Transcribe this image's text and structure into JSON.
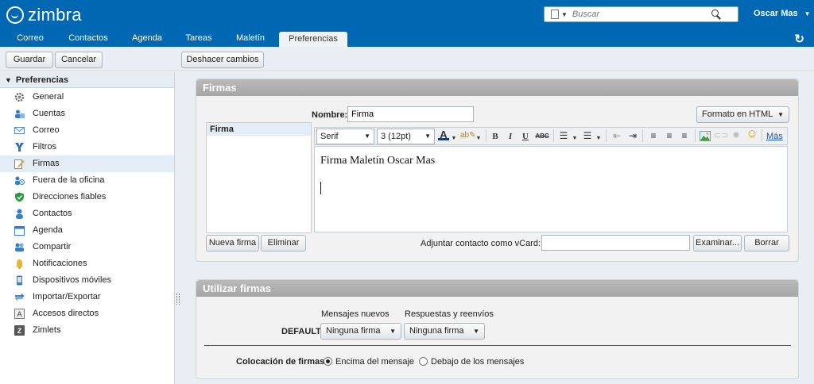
{
  "app": {
    "logo_text": "zimbra",
    "user_name": "Oscar Mas",
    "search_placeholder": "Buscar"
  },
  "tabs": [
    {
      "label": "Correo"
    },
    {
      "label": "Contactos"
    },
    {
      "label": "Agenda"
    },
    {
      "label": "Tareas"
    },
    {
      "label": "Maletín"
    },
    {
      "label": "Preferencias",
      "active": true
    }
  ],
  "toolbar": {
    "save": "Guardar",
    "cancel": "Cancelar",
    "undo": "Deshacer cambios"
  },
  "sidebar": {
    "header": "Preferencias",
    "items": [
      {
        "label": "General",
        "icon": "gear-icon"
      },
      {
        "label": "Cuentas",
        "icon": "accounts-icon"
      },
      {
        "label": "Correo",
        "icon": "mail-icon"
      },
      {
        "label": "Filtros",
        "icon": "filter-icon"
      },
      {
        "label": "Firmas",
        "icon": "signature-icon",
        "selected": true
      },
      {
        "label": "Fuera de la oficina",
        "icon": "out-of-office-icon"
      },
      {
        "label": "Direcciones fiables",
        "icon": "shield-icon"
      },
      {
        "label": "Contactos",
        "icon": "contact-icon"
      },
      {
        "label": "Agenda",
        "icon": "calendar-icon"
      },
      {
        "label": "Compartir",
        "icon": "share-icon"
      },
      {
        "label": "Notificaciones",
        "icon": "bell-icon"
      },
      {
        "label": "Dispositivos móviles",
        "icon": "mobile-icon"
      },
      {
        "label": "Importar/Exportar",
        "icon": "import-export-icon"
      },
      {
        "label": "Accesos directos",
        "icon": "shortcut-icon"
      },
      {
        "label": "Zimlets",
        "icon": "zimlet-icon"
      }
    ]
  },
  "signatures": {
    "title": "Firmas",
    "list": [
      "Firma"
    ],
    "name_label": "Nombre:",
    "name_value": "Firma",
    "format": "Formato en HTML",
    "font_family": "Serif",
    "font_size": "3 (12pt)",
    "more": "Más",
    "body_text": "Firma Maletín Oscar Mas",
    "new_button": "Nueva firma",
    "delete_button": "Eliminar",
    "vcard_label": "Adjuntar contacto como vCard:",
    "browse_button": "Examinar...",
    "clear_button": "Borrar"
  },
  "use_signatures": {
    "title": "Utilizar firmas",
    "col_new": "Mensajes nuevos",
    "col_reply": "Respuestas y reenvíos",
    "account_label": "DEFAULT:",
    "new_value": "Ninguna firma",
    "reply_value": "Ninguna firma",
    "placement_label": "Colocación de firmas:",
    "option_top": "Encima del mensaje",
    "option_bottom": "Debajo de los mensajes",
    "selected": "top"
  },
  "colors": {
    "brand": "#0068b2",
    "panel_header": "#b0b0b0",
    "selected_row": "#e4ecf5"
  }
}
